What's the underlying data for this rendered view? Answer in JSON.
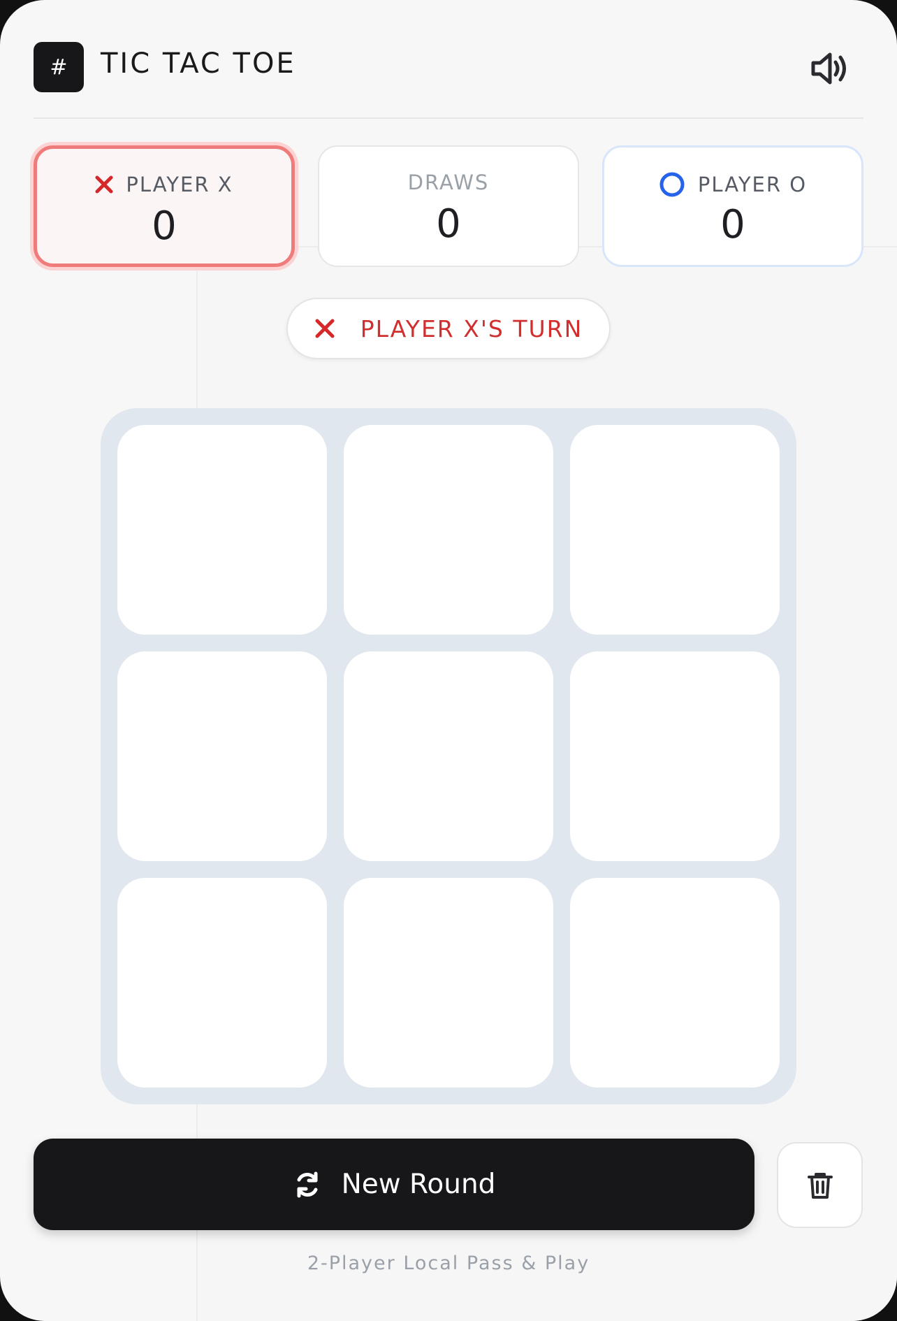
{
  "header": {
    "logo_glyph": "#",
    "title": "TIC TAC TOE",
    "sound_icon": "speaker-volume-icon"
  },
  "scores": {
    "x": {
      "label": "PLAYER X",
      "value": "0",
      "icon": "x-mark-icon",
      "color": "#d62828"
    },
    "draws": {
      "label": "DRAWS",
      "value": "0"
    },
    "o": {
      "label": "PLAYER O",
      "value": "0",
      "icon": "o-ring-icon",
      "color": "#2563eb"
    }
  },
  "turn": {
    "text": "PLAYER X'S TURN",
    "icon": "x-mark-icon",
    "color": "#d12f2f"
  },
  "board": {
    "cells": [
      "",
      "",
      "",
      "",
      "",
      "",
      "",
      "",
      ""
    ]
  },
  "actions": {
    "new_round_label": "New Round",
    "new_round_icon": "refresh-icon",
    "reset_icon": "trash-icon"
  },
  "footer": {
    "text": "2-Player Local Pass & Play"
  },
  "colors": {
    "accent_dark": "#17171a",
    "board_bg": "#e1e7ef",
    "x_highlight": "#ef7b7b",
    "o_border": "#d8e6fb"
  }
}
